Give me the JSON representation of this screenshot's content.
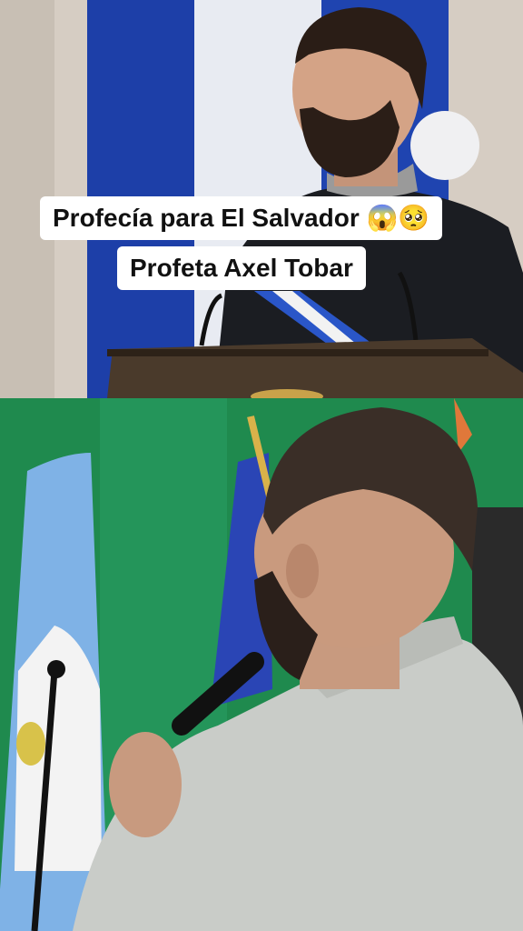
{
  "caption": {
    "line1": "Profecía para El Salvador 😱🥺",
    "line2": "Profeta Axel Tobar"
  },
  "colors": {
    "flag_blue": "#1d3fa8",
    "banner_green": "#1f8a4e",
    "light_blue_flag": "#7fb2e6",
    "suit_dark": "#1b1d22",
    "jacket_grey": "#c9ccc8"
  }
}
